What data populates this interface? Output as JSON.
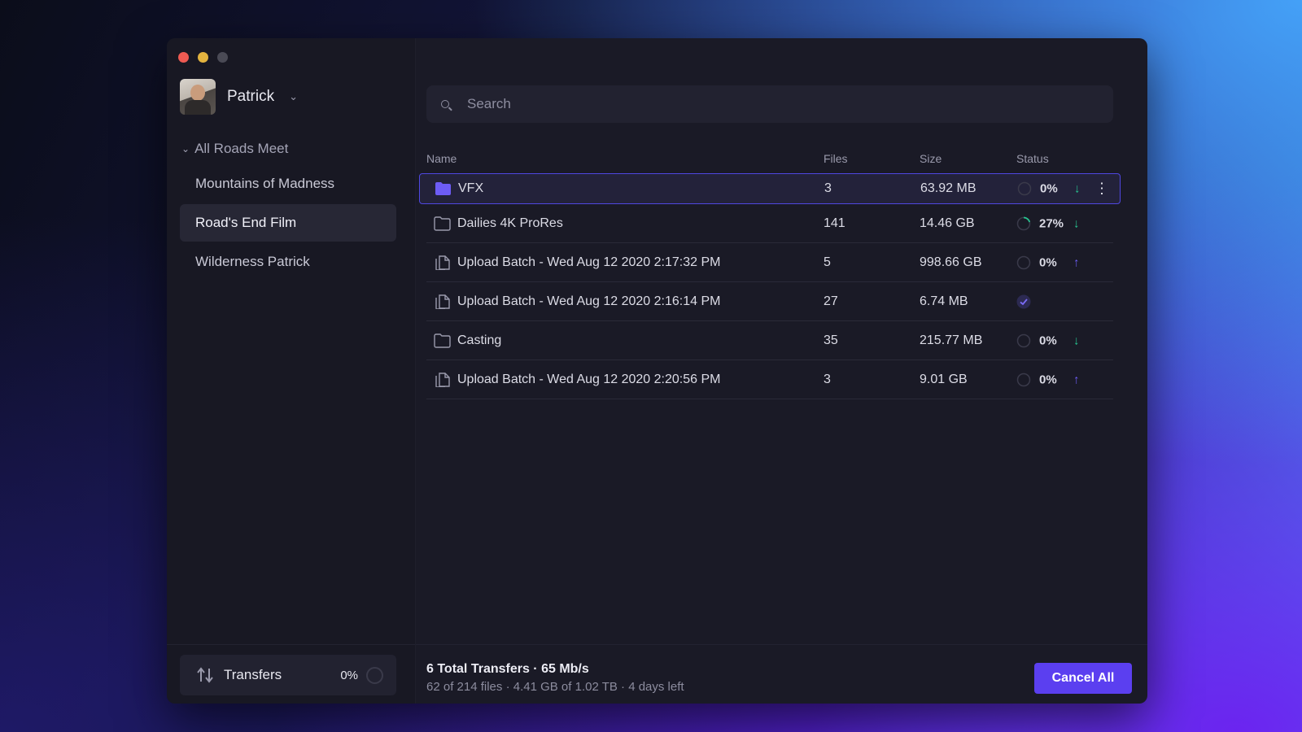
{
  "user": {
    "name": "Patrick"
  },
  "sidebar": {
    "group_label": "All Roads Meet",
    "items": [
      {
        "label": "Mountains of Madness",
        "active": false
      },
      {
        "label": "Road's End Film",
        "active": true
      },
      {
        "label": "Wilderness Patrick",
        "active": false
      }
    ],
    "transfers": {
      "label": "Transfers",
      "percent": "0%"
    }
  },
  "search": {
    "placeholder": "Search"
  },
  "table": {
    "headers": {
      "name": "Name",
      "files": "Files",
      "size": "Size",
      "status": "Status"
    },
    "rows": [
      {
        "icon": "folder-filled-icon",
        "name": "VFX",
        "files": "3",
        "size": "63.92 MB",
        "percent": "0%",
        "direction": "down",
        "progress": 0
      },
      {
        "icon": "folder-icon",
        "name": "Dailies 4K ProRes",
        "files": "141",
        "size": "14.46 GB",
        "percent": "27%",
        "direction": "down",
        "progress": 0.27
      },
      {
        "icon": "document-icon",
        "name": "Upload Batch - Wed Aug 12 2020 2:17:32 PM",
        "files": "5",
        "size": "998.66 GB",
        "percent": "0%",
        "direction": "up",
        "progress": 0
      },
      {
        "icon": "document-icon",
        "name": "Upload Batch - Wed Aug 12 2020 2:16:14 PM",
        "files": "27",
        "size": "6.74 MB",
        "percent": "",
        "direction": "complete",
        "progress": 1
      },
      {
        "icon": "folder-icon",
        "name": "Casting",
        "files": "35",
        "size": "215.77 MB",
        "percent": "0%",
        "direction": "down",
        "progress": 0
      },
      {
        "icon": "document-icon",
        "name": "Upload Batch - Wed Aug 12 2020 2:20:56 PM",
        "files": "3",
        "size": "9.01 GB",
        "percent": "0%",
        "direction": "up",
        "progress": 0
      }
    ]
  },
  "footer": {
    "summary": "6 Total Transfers · 65 Mb/s",
    "detail": "62 of 214 files · 4.41 GB of 1.02 TB · 4 days left",
    "cancel_label": "Cancel All"
  },
  "colors": {
    "accent": "#5b3ff0",
    "download": "#27c28f",
    "upload": "#6d5cf5"
  }
}
